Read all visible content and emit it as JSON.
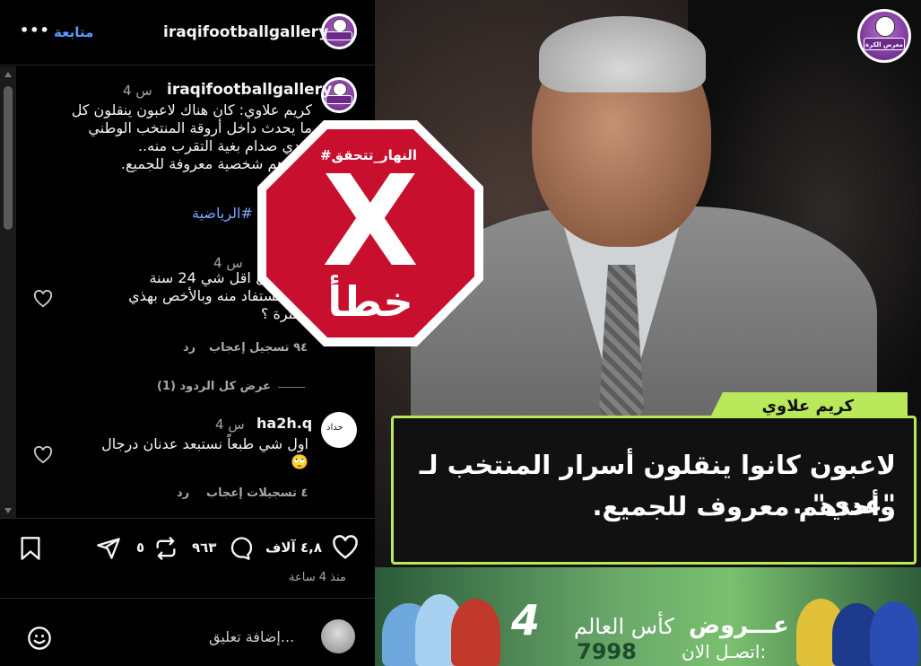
{
  "header": {
    "username": "iraqifootballgallery",
    "follow_label": "متابعة",
    "more_label": "•••"
  },
  "caption": {
    "username": "iraqifootballgallery",
    "time": "4 س",
    "lines": [
      "كريم علاوي: كان هناك لاعبون ينقلون كل",
      "ما يحدث داخل أروقة المنتخب الوطني",
      "لعدي صدام بغية التقرب منه..",
      "وأحدهم شخصية معروفة للجميع."
    ],
    "hashtag": "الرياضية#"
  },
  "comments": [
    {
      "time": "4 س",
      "lines": [
        "هذي قبل اقل شي 24 سنة",
        "شنو تستفاد منه وبالأخص بهذي",
        "الفترة ؟"
      ],
      "likes": "٩٤ تسجيل إعجاب",
      "reply": "رد",
      "view_replies": "عرض كل الردود (1)"
    },
    {
      "username": "ha2h.q",
      "avatar_text": "حداد",
      "time": "4 س",
      "lines": [
        "اول شي طبعاً نستبعد عدنان درجال",
        "🙄"
      ],
      "likes": "٤ تسجيلات إعجاب",
      "reply": "رد"
    }
  ],
  "actions": {
    "likes_count": "٤,٨ آلاف",
    "comments_count": "٩٦٣",
    "reposts_count": "٥",
    "posted_ago": "منذ 4 ساعة"
  },
  "add_comment": {
    "placeholder": "إضافة تعليق..."
  },
  "stop_sign": {
    "hashtag": "#النهار_تتحقق",
    "verdict": "خطأ",
    "color": "#c8102e"
  },
  "post_image": {
    "logo_text": "معرض الكرة",
    "name_tag": "كريم علاوي",
    "headline_lines": [
      "لاعبون كانوا ينقلون أسرار المنتخب لـ \"عدي\"..",
      "وأحدهم معروف للجميع."
    ],
    "accent": "#b9e85a",
    "ad": {
      "title": "عـــروض",
      "subtitle": "كأس العالم",
      "call": "اتصـل الان:",
      "number": "7998",
      "brand": "4"
    }
  }
}
